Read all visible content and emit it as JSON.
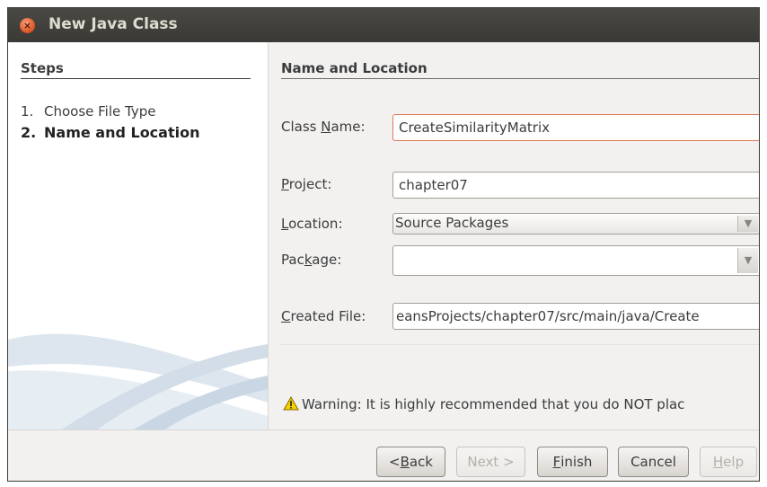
{
  "window": {
    "title": "New Java Class"
  },
  "steps": {
    "heading": "Steps",
    "items": [
      {
        "num": "1.",
        "label": "Choose File Type"
      },
      {
        "num": "2.",
        "label": "Name and Location"
      }
    ]
  },
  "form": {
    "section_title": "Name and Location",
    "class_name": {
      "label_pre": "Class ",
      "label_key": "N",
      "label_post": "ame:",
      "value": "CreateSimilarityMatrix"
    },
    "project": {
      "label_pre": "",
      "label_key": "P",
      "label_post": "roject:",
      "value": "chapter07"
    },
    "location": {
      "label_pre": "",
      "label_key": "L",
      "label_post": "ocation:",
      "value": "Source Packages"
    },
    "package": {
      "label_pre": "Pac",
      "label_key": "k",
      "label_post": "age:",
      "value": ""
    },
    "created_file": {
      "label_pre": "",
      "label_key": "C",
      "label_post": "reated File:",
      "value": "eansProjects/chapter07/src/main/java/Create"
    },
    "warning": "Warning: It is highly recommended that you do NOT plac"
  },
  "buttons": {
    "back": {
      "pre": "< ",
      "key": "B",
      "post": "ack"
    },
    "next": {
      "pre": "",
      "key": "",
      "post": "Next >"
    },
    "finish": {
      "pre": "",
      "key": "F",
      "post": "inish"
    },
    "cancel": {
      "pre": "",
      "key": "",
      "post": "Cancel"
    },
    "help": {
      "pre": "",
      "key": "H",
      "post": "elp"
    }
  },
  "colors": {
    "titlebar": "#3c3b37",
    "focus_border": "#e0785a",
    "close_button": "#e05a2b"
  }
}
